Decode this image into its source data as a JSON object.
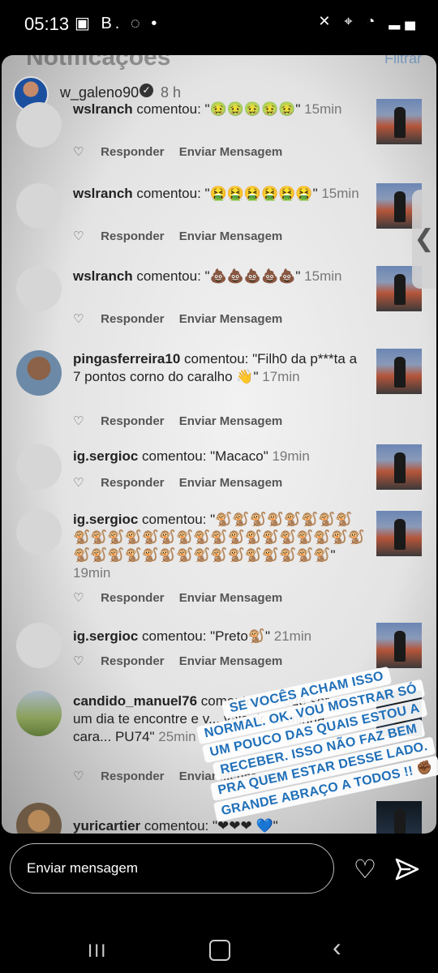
{
  "status_bar": {
    "time": "05:13",
    "left_icons": "▣ B. ◌ •",
    "right_icons": "✕ ⌖ ◔ ▂▄"
  },
  "background_header": {
    "title": "Notificações",
    "right_link": "Filtrar"
  },
  "story_user": {
    "username": "w_galeno90",
    "time": "8 h",
    "verified": true
  },
  "notifications": [
    {
      "user": "wslranch",
      "comment": " comentou: \"🤢🤢🤢🤢🤢\"",
      "time": "15min",
      "reply_label": "Responder",
      "message_label": "Enviar Mensagem"
    },
    {
      "user": "wslranch",
      "comment": " comentou: \"🤮🤮🤮🤮🤮🤮\"",
      "time": "15min",
      "reply_label": "Responder",
      "message_label": "Enviar Mensagem"
    },
    {
      "user": "wslranch",
      "comment": " comentou: \"💩💩💩💩💩\"",
      "time": "15min",
      "reply_label": "Responder",
      "message_label": "Enviar Mensagem"
    },
    {
      "user": "pingasferreira10",
      "comment": " comentou: \"Filh0 da p***ta a 7 pontos corno do caralho 👋\"",
      "time": "17min",
      "reply_label": "Responder",
      "message_label": "Enviar Mensagem"
    },
    {
      "user": "ig.sergioc",
      "comment": " comentou: \"Macaco\"",
      "time": "19min",
      "reply_label": "Responder",
      "message_label": "Enviar Mensagem"
    },
    {
      "user": "ig.sergioc",
      "comment": " comentou: \"🐒🐒🐒🐒🐒🐒🐒🐒🐒🐒🐒🐒🐒🐒🐒🐒🐒🐒🐒🐒🐒🐒🐒🐒🐒🐒🐒🐒🐒🐒🐒🐒🐒🐒🐒🐒🐒🐒🐒🐒\"",
      "time": "19min",
      "reply_label": "Responder",
      "message_label": "Enviar Mensagem"
    },
    {
      "user": "ig.sergioc",
      "comment": " comentou: \"Preto🐒\"",
      "time": "21min",
      "reply_label": "Responder",
      "message_label": "Enviar Mensagem"
    },
    {
      "user": "candido_manuel76",
      "comment": " comentou: \"Pode ser que um dia te encontre e v... vais rir na minha cara... PU74\"",
      "time": "25min",
      "reply_label": "Responder",
      "message_label": "Enviar Mensagem"
    },
    {
      "user": "yuricartier",
      "comment": " comentou: \"❤❤❤ 💙\"",
      "time": "",
      "reply_label": "",
      "message_label": ""
    }
  ],
  "caption": [
    "SE VOCÊS ACHAM ISSO",
    "NORMAL. OK. VOU MOSTRAR SÓ",
    "UM POUCO DAS QUAIS ESTOU A",
    "RECEBER. ISSO NÃO FAZ BEM",
    "PRA QUEM ESTAR DESSE LADO.",
    "GRANDE ABRAÇO A TODOS !! ✊🏾"
  ],
  "side_handle_icon": "chevron-left-icon",
  "reply_bar": {
    "placeholder": "Enviar mensagem"
  },
  "nav": {
    "recents": "III",
    "back": "‹"
  }
}
